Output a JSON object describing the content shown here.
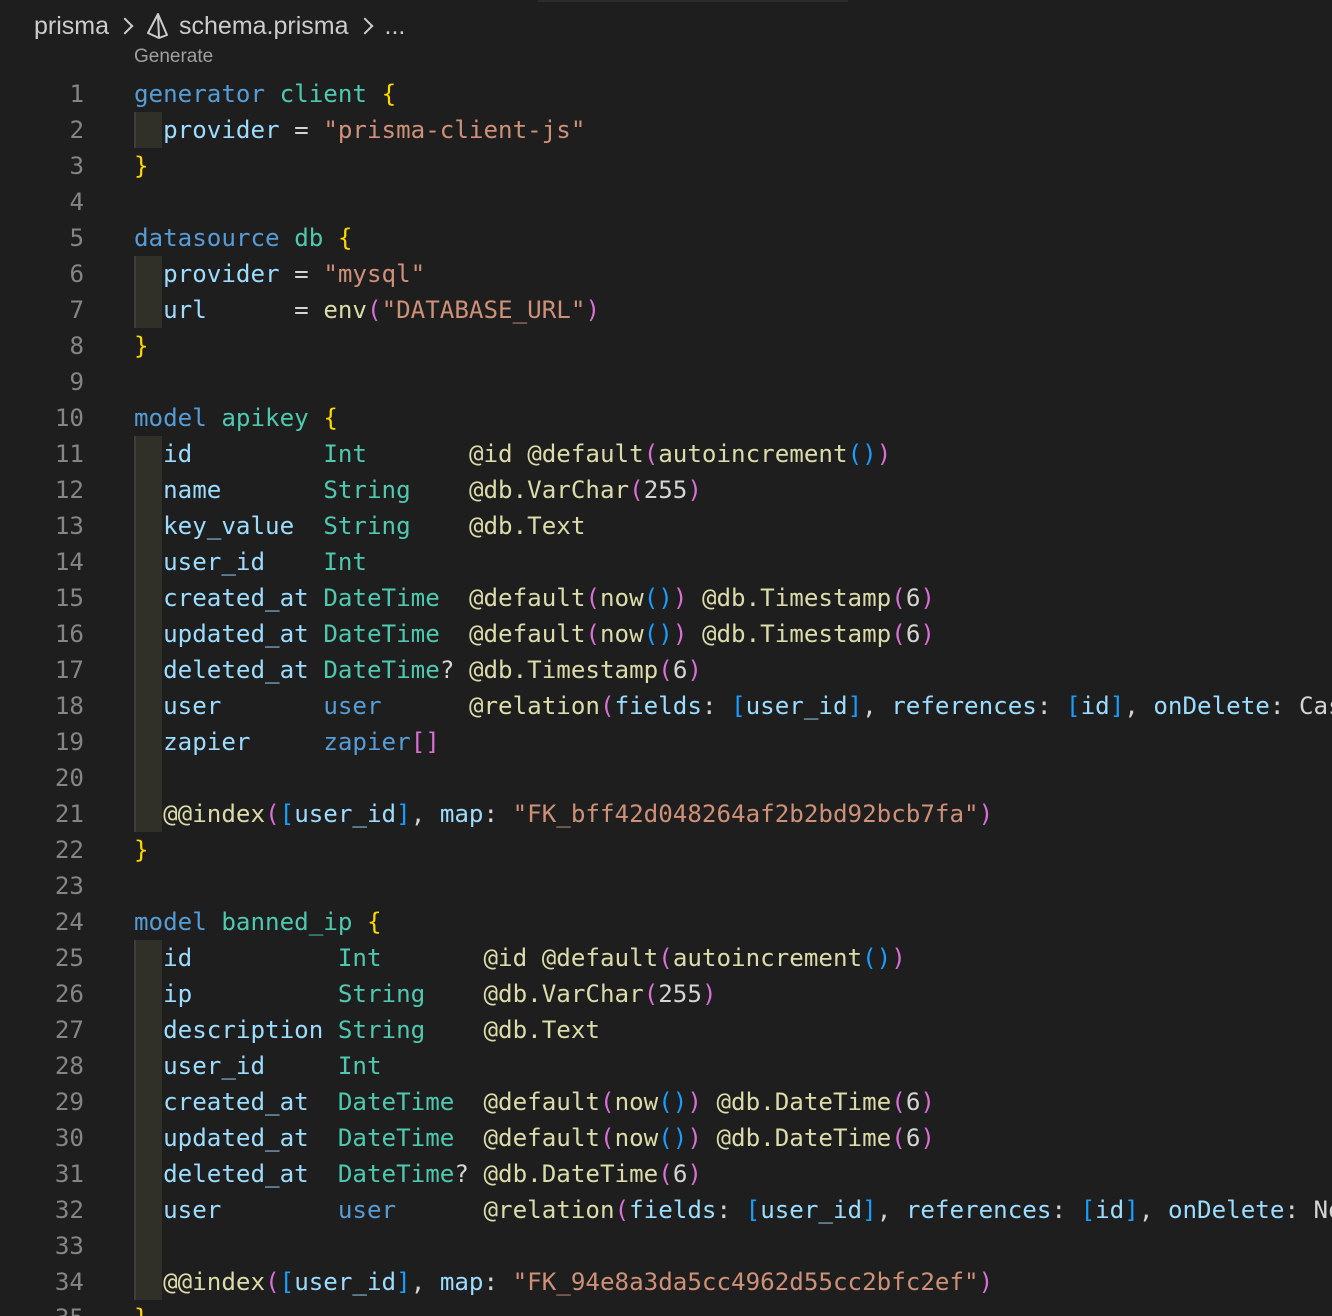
{
  "breadcrumb": {
    "folder": "prisma",
    "file": "schema.prisma",
    "more": "..."
  },
  "codelens": {
    "label": "Generate"
  },
  "theme": {
    "background": "#1e1e1e",
    "line_number": "#858585",
    "keyword": "#569cd6",
    "type": "#4ec9b0",
    "field": "#9cdcfe",
    "string": "#ce9178",
    "function": "#dcdcaa",
    "bracket_1": "#ffd700",
    "bracket_2": "#da70d6",
    "bracket_3": "#179fff"
  },
  "editor": {
    "lines": [
      {
        "n": "1",
        "t": [
          [
            "kw",
            "generator"
          ],
          [
            "op",
            " "
          ],
          [
            "ty",
            "client"
          ],
          [
            "op",
            " "
          ],
          [
            "b1",
            "{"
          ]
        ]
      },
      {
        "n": "2",
        "g": 1,
        "t": [
          [
            "op",
            "  "
          ],
          [
            "fd",
            "provider"
          ],
          [
            "op",
            " = "
          ],
          [
            "str",
            "\"prisma-client-js\""
          ]
        ]
      },
      {
        "n": "3",
        "t": [
          [
            "b1",
            "}"
          ]
        ]
      },
      {
        "n": "4",
        "t": []
      },
      {
        "n": "5",
        "t": [
          [
            "kw",
            "datasource"
          ],
          [
            "op",
            " "
          ],
          [
            "ty",
            "db"
          ],
          [
            "op",
            " "
          ],
          [
            "b1",
            "{"
          ]
        ]
      },
      {
        "n": "6",
        "g": 1,
        "t": [
          [
            "op",
            "  "
          ],
          [
            "fd",
            "provider"
          ],
          [
            "op",
            " = "
          ],
          [
            "str",
            "\"mysql\""
          ]
        ]
      },
      {
        "n": "7",
        "g": 1,
        "t": [
          [
            "op",
            "  "
          ],
          [
            "fd",
            "url"
          ],
          [
            "op",
            "      = "
          ],
          [
            "fn",
            "env"
          ],
          [
            "b2",
            "("
          ],
          [
            "str",
            "\"DATABASE_URL\""
          ],
          [
            "b2",
            ")"
          ]
        ]
      },
      {
        "n": "8",
        "t": [
          [
            "b1",
            "}"
          ]
        ]
      },
      {
        "n": "9",
        "t": []
      },
      {
        "n": "10",
        "t": [
          [
            "kw",
            "model"
          ],
          [
            "op",
            " "
          ],
          [
            "ty",
            "apikey"
          ],
          [
            "op",
            " "
          ],
          [
            "b1",
            "{"
          ]
        ]
      },
      {
        "n": "11",
        "g": 1,
        "t": [
          [
            "op",
            "  "
          ],
          [
            "fd",
            "id"
          ],
          [
            "op",
            "         "
          ],
          [
            "ty",
            "Int"
          ],
          [
            "op",
            "       "
          ],
          [
            "fn",
            "@id"
          ],
          [
            "op",
            " "
          ],
          [
            "fn",
            "@default"
          ],
          [
            "b2",
            "("
          ],
          [
            "fn",
            "autoincrement"
          ],
          [
            "b3",
            "()"
          ],
          [
            "b2",
            ")"
          ]
        ]
      },
      {
        "n": "12",
        "g": 1,
        "t": [
          [
            "op",
            "  "
          ],
          [
            "fd",
            "name"
          ],
          [
            "op",
            "       "
          ],
          [
            "ty",
            "String"
          ],
          [
            "op",
            "    "
          ],
          [
            "fn",
            "@db.VarChar"
          ],
          [
            "b2",
            "("
          ],
          [
            "op",
            "255"
          ],
          [
            "b2",
            ")"
          ]
        ]
      },
      {
        "n": "13",
        "g": 1,
        "t": [
          [
            "op",
            "  "
          ],
          [
            "fd",
            "key_value"
          ],
          [
            "op",
            "  "
          ],
          [
            "ty",
            "String"
          ],
          [
            "op",
            "    "
          ],
          [
            "fn",
            "@db.Text"
          ]
        ]
      },
      {
        "n": "14",
        "g": 1,
        "t": [
          [
            "op",
            "  "
          ],
          [
            "fd",
            "user_id"
          ],
          [
            "op",
            "    "
          ],
          [
            "ty",
            "Int"
          ]
        ]
      },
      {
        "n": "15",
        "g": 1,
        "t": [
          [
            "op",
            "  "
          ],
          [
            "fd",
            "created_at"
          ],
          [
            "op",
            " "
          ],
          [
            "ty",
            "DateTime"
          ],
          [
            "op",
            "  "
          ],
          [
            "fn",
            "@default"
          ],
          [
            "b2",
            "("
          ],
          [
            "fn",
            "now"
          ],
          [
            "b3",
            "()"
          ],
          [
            "b2",
            ")"
          ],
          [
            "op",
            " "
          ],
          [
            "fn",
            "@db.Timestamp"
          ],
          [
            "b2",
            "("
          ],
          [
            "op",
            "6"
          ],
          [
            "b2",
            ")"
          ]
        ]
      },
      {
        "n": "16",
        "g": 1,
        "t": [
          [
            "op",
            "  "
          ],
          [
            "fd",
            "updated_at"
          ],
          [
            "op",
            " "
          ],
          [
            "ty",
            "DateTime"
          ],
          [
            "op",
            "  "
          ],
          [
            "fn",
            "@default"
          ],
          [
            "b2",
            "("
          ],
          [
            "fn",
            "now"
          ],
          [
            "b3",
            "()"
          ],
          [
            "b2",
            ")"
          ],
          [
            "op",
            " "
          ],
          [
            "fn",
            "@db.Timestamp"
          ],
          [
            "b2",
            "("
          ],
          [
            "op",
            "6"
          ],
          [
            "b2",
            ")"
          ]
        ]
      },
      {
        "n": "17",
        "g": 1,
        "t": [
          [
            "op",
            "  "
          ],
          [
            "fd",
            "deleted_at"
          ],
          [
            "op",
            " "
          ],
          [
            "ty",
            "DateTime"
          ],
          [
            "op",
            "? "
          ],
          [
            "fn",
            "@db.Timestamp"
          ],
          [
            "b2",
            "("
          ],
          [
            "op",
            "6"
          ],
          [
            "b2",
            ")"
          ]
        ]
      },
      {
        "n": "18",
        "g": 1,
        "t": [
          [
            "op",
            "  "
          ],
          [
            "fd",
            "user"
          ],
          [
            "op",
            "       "
          ],
          [
            "kw",
            "user"
          ],
          [
            "op",
            "      "
          ],
          [
            "fn",
            "@relation"
          ],
          [
            "b2",
            "("
          ],
          [
            "fd",
            "fields"
          ],
          [
            "op",
            ": "
          ],
          [
            "b3",
            "["
          ],
          [
            "fd",
            "user_id"
          ],
          [
            "b3",
            "]"
          ],
          [
            "op",
            ", "
          ],
          [
            "fd",
            "references"
          ],
          [
            "op",
            ": "
          ],
          [
            "b3",
            "["
          ],
          [
            "fd",
            "id"
          ],
          [
            "b3",
            "]"
          ],
          [
            "op",
            ", "
          ],
          [
            "fd",
            "onDelete"
          ],
          [
            "op",
            ": Cascade, onUpdate: NoAction"
          ],
          [
            "b2",
            ")"
          ]
        ]
      },
      {
        "n": "19",
        "g": 1,
        "t": [
          [
            "op",
            "  "
          ],
          [
            "fd",
            "zapier"
          ],
          [
            "op",
            "     "
          ],
          [
            "kw",
            "zapier"
          ],
          [
            "b2",
            "[]"
          ]
        ]
      },
      {
        "n": "20",
        "g": 1,
        "t": []
      },
      {
        "n": "21",
        "g": 1,
        "t": [
          [
            "op",
            "  "
          ],
          [
            "fn",
            "@@index"
          ],
          [
            "b2",
            "("
          ],
          [
            "b3",
            "["
          ],
          [
            "fd",
            "user_id"
          ],
          [
            "b3",
            "]"
          ],
          [
            "op",
            ", "
          ],
          [
            "fd",
            "map"
          ],
          [
            "op",
            ": "
          ],
          [
            "str",
            "\"FK_bff42d048264af2b2bd92bcb7fa\""
          ],
          [
            "b2",
            ")"
          ]
        ]
      },
      {
        "n": "22",
        "t": [
          [
            "b1",
            "}"
          ]
        ]
      },
      {
        "n": "23",
        "t": []
      },
      {
        "n": "24",
        "t": [
          [
            "kw",
            "model"
          ],
          [
            "op",
            " "
          ],
          [
            "ty",
            "banned_ip"
          ],
          [
            "op",
            " "
          ],
          [
            "b1",
            "{"
          ]
        ]
      },
      {
        "n": "25",
        "g": 1,
        "t": [
          [
            "op",
            "  "
          ],
          [
            "fd",
            "id"
          ],
          [
            "op",
            "          "
          ],
          [
            "ty",
            "Int"
          ],
          [
            "op",
            "       "
          ],
          [
            "fn",
            "@id"
          ],
          [
            "op",
            " "
          ],
          [
            "fn",
            "@default"
          ],
          [
            "b2",
            "("
          ],
          [
            "fn",
            "autoincrement"
          ],
          [
            "b3",
            "()"
          ],
          [
            "b2",
            ")"
          ]
        ]
      },
      {
        "n": "26",
        "g": 1,
        "t": [
          [
            "op",
            "  "
          ],
          [
            "fd",
            "ip"
          ],
          [
            "op",
            "          "
          ],
          [
            "ty",
            "String"
          ],
          [
            "op",
            "    "
          ],
          [
            "fn",
            "@db.VarChar"
          ],
          [
            "b2",
            "("
          ],
          [
            "op",
            "255"
          ],
          [
            "b2",
            ")"
          ]
        ]
      },
      {
        "n": "27",
        "g": 1,
        "t": [
          [
            "op",
            "  "
          ],
          [
            "fd",
            "description"
          ],
          [
            "op",
            " "
          ],
          [
            "ty",
            "String"
          ],
          [
            "op",
            "    "
          ],
          [
            "fn",
            "@db.Text"
          ]
        ]
      },
      {
        "n": "28",
        "g": 1,
        "t": [
          [
            "op",
            "  "
          ],
          [
            "fd",
            "user_id"
          ],
          [
            "op",
            "     "
          ],
          [
            "ty",
            "Int"
          ]
        ]
      },
      {
        "n": "29",
        "g": 1,
        "t": [
          [
            "op",
            "  "
          ],
          [
            "fd",
            "created_at"
          ],
          [
            "op",
            "  "
          ],
          [
            "ty",
            "DateTime"
          ],
          [
            "op",
            "  "
          ],
          [
            "fn",
            "@default"
          ],
          [
            "b2",
            "("
          ],
          [
            "fn",
            "now"
          ],
          [
            "b3",
            "()"
          ],
          [
            "b2",
            ")"
          ],
          [
            "op",
            " "
          ],
          [
            "fn",
            "@db.DateTime"
          ],
          [
            "b2",
            "("
          ],
          [
            "op",
            "6"
          ],
          [
            "b2",
            ")"
          ]
        ]
      },
      {
        "n": "30",
        "g": 1,
        "t": [
          [
            "op",
            "  "
          ],
          [
            "fd",
            "updated_at"
          ],
          [
            "op",
            "  "
          ],
          [
            "ty",
            "DateTime"
          ],
          [
            "op",
            "  "
          ],
          [
            "fn",
            "@default"
          ],
          [
            "b2",
            "("
          ],
          [
            "fn",
            "now"
          ],
          [
            "b3",
            "()"
          ],
          [
            "b2",
            ")"
          ],
          [
            "op",
            " "
          ],
          [
            "fn",
            "@db.DateTime"
          ],
          [
            "b2",
            "("
          ],
          [
            "op",
            "6"
          ],
          [
            "b2",
            ")"
          ]
        ]
      },
      {
        "n": "31",
        "g": 1,
        "t": [
          [
            "op",
            "  "
          ],
          [
            "fd",
            "deleted_at"
          ],
          [
            "op",
            "  "
          ],
          [
            "ty",
            "DateTime"
          ],
          [
            "op",
            "? "
          ],
          [
            "fn",
            "@db.DateTime"
          ],
          [
            "b2",
            "("
          ],
          [
            "op",
            "6"
          ],
          [
            "b2",
            ")"
          ]
        ]
      },
      {
        "n": "32",
        "g": 1,
        "t": [
          [
            "op",
            "  "
          ],
          [
            "fd",
            "user"
          ],
          [
            "op",
            "        "
          ],
          [
            "kw",
            "user"
          ],
          [
            "op",
            "      "
          ],
          [
            "fn",
            "@relation"
          ],
          [
            "b2",
            "("
          ],
          [
            "fd",
            "fields"
          ],
          [
            "op",
            ": "
          ],
          [
            "b3",
            "["
          ],
          [
            "fd",
            "user_id"
          ],
          [
            "b3",
            "]"
          ],
          [
            "op",
            ", "
          ],
          [
            "fd",
            "references"
          ],
          [
            "op",
            ": "
          ],
          [
            "b3",
            "["
          ],
          [
            "fd",
            "id"
          ],
          [
            "b3",
            "]"
          ],
          [
            "op",
            ", "
          ],
          [
            "fd",
            "onDelete"
          ],
          [
            "op",
            ": NoAction, onUpdate: NoAction"
          ],
          [
            "b2",
            ")"
          ]
        ]
      },
      {
        "n": "33",
        "g": 1,
        "t": []
      },
      {
        "n": "34",
        "g": 1,
        "t": [
          [
            "op",
            "  "
          ],
          [
            "fn",
            "@@index"
          ],
          [
            "b2",
            "("
          ],
          [
            "b3",
            "["
          ],
          [
            "fd",
            "user_id"
          ],
          [
            "b3",
            "]"
          ],
          [
            "op",
            ", "
          ],
          [
            "fd",
            "map"
          ],
          [
            "op",
            ": "
          ],
          [
            "str",
            "\"FK_94e8a3da5cc4962d55cc2bfc2ef\""
          ],
          [
            "b2",
            ")"
          ]
        ]
      },
      {
        "n": "35",
        "t": [
          [
            "b1",
            "}"
          ]
        ]
      }
    ]
  }
}
